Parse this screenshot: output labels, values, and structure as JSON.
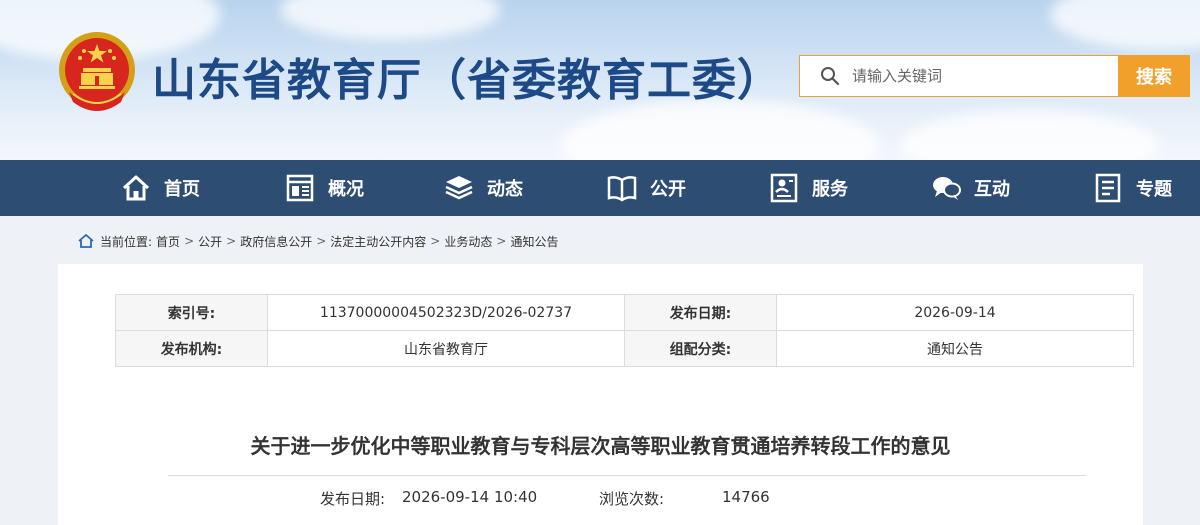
{
  "header": {
    "site_title": "山东省教育厅（省委教育工委）",
    "search": {
      "placeholder": "请输入关键词",
      "button_label": "搜索"
    }
  },
  "nav": {
    "items": [
      {
        "label": "首页",
        "icon": "home-icon"
      },
      {
        "label": "概况",
        "icon": "overview-icon"
      },
      {
        "label": "动态",
        "icon": "news-stack-icon"
      },
      {
        "label": "公开",
        "icon": "book-icon"
      },
      {
        "label": "服务",
        "icon": "service-icon"
      },
      {
        "label": "互动",
        "icon": "chat-icon"
      },
      {
        "label": "专题",
        "icon": "document-icon"
      }
    ]
  },
  "breadcrumb": {
    "prefix": "当前位置:",
    "items": [
      "首页",
      "公开",
      "政府信息公开",
      "法定主动公开内容",
      "业务动态",
      "通知公告"
    ],
    "separator": ">"
  },
  "meta": {
    "index_label": "索引号:",
    "index_value": "11370000004502323D/2026-02737",
    "date_label": "发布日期:",
    "date_value": "2026-09-14",
    "org_label": "发布机构:",
    "org_value": "山东省教育厅",
    "category_label": "组配分类:",
    "category_value": "通知公告"
  },
  "article": {
    "title": "关于进一步优化中等职业教育与专科层次高等职业教育贯通培养转段工作的意见",
    "publish_label": "发布日期:",
    "publish_value": "2026-09-14 10:40",
    "views_label": "浏览次数:",
    "views_value": "14766"
  },
  "colors": {
    "nav_bg": "#2e4d72",
    "title_blue": "#1d4a86",
    "search_orange": "#f0a02b"
  }
}
